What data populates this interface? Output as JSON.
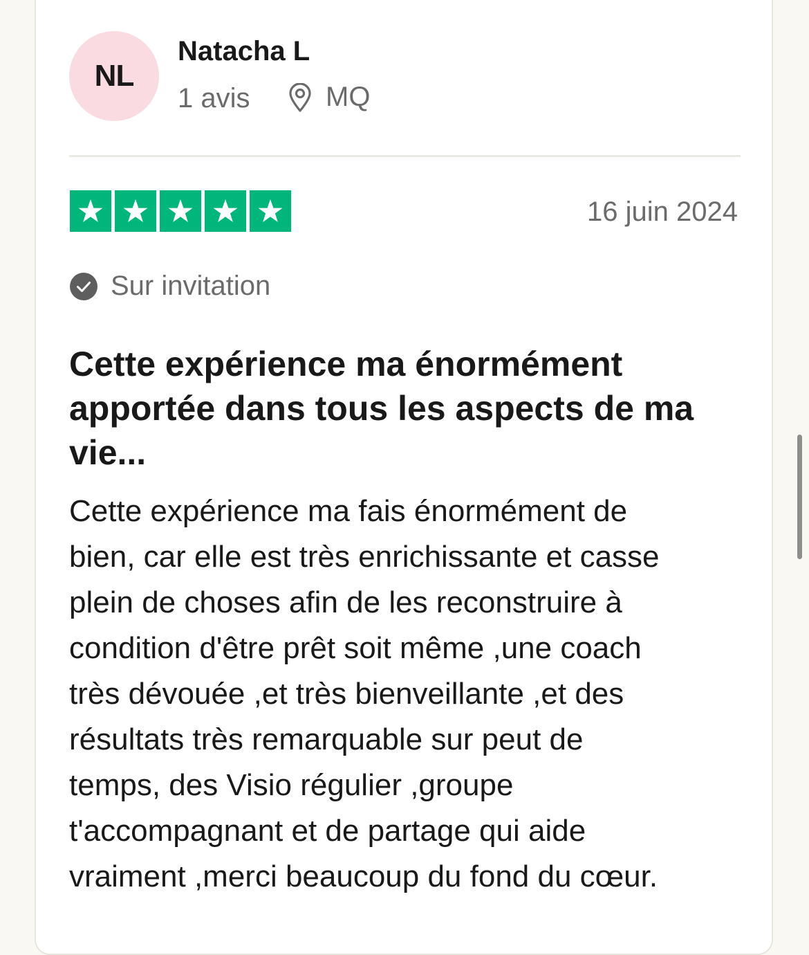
{
  "reviewer": {
    "initials": "NL",
    "name": "Natacha L",
    "review_count": "1 avis",
    "location": "MQ",
    "avatar_color": "#fadbe1"
  },
  "review": {
    "rating": 5,
    "rating_max": 5,
    "star_color": "#00b67a",
    "date": "16 juin 2024",
    "verification_label": "Sur invitation",
    "title_lines": [
      "Cette expérience ma énormément",
      "apportée dans tous les aspects de ma",
      "vie..."
    ],
    "body_lines": [
      "Cette expérience ma fais énormément de",
      "bien, car elle est très enrichissante et casse",
      "plein de choses afin de les reconstruire à",
      "condition d'être prêt soit même ,une coach",
      "très dévouée ,et très bienveillante ,et des",
      "résultats très remarquable sur peut de",
      "temps, des Visio régulier ,groupe",
      "t'accompagnant et de partage qui aide",
      "vraiment ,merci beaucoup du fond du cœur."
    ]
  },
  "icons": {
    "location": "location-pin-icon",
    "verified": "check-circle-icon",
    "star": "star-icon"
  }
}
